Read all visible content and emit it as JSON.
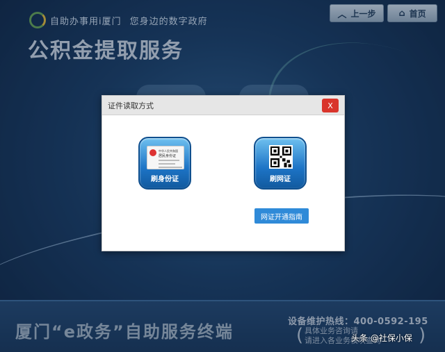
{
  "header": {
    "brand_name": "自助办事用i厦门",
    "slogan": "您身边的数字政府",
    "service_title": "公积金提取服务",
    "back_button": "上一步",
    "home_button": "首页"
  },
  "modal": {
    "title": "证件读取方式",
    "close_label": "X",
    "options": [
      {
        "label": "刷身份证",
        "icon": "id-card-icon"
      },
      {
        "label": "刷网证",
        "icon": "qr-code-icon"
      }
    ],
    "id_card": {
      "line1": "中华人民共和国",
      "line2": "居民身份证"
    },
    "guide_button": "网证开通指南"
  },
  "footer": {
    "terminal_title": "厦门“e政务”自助服务终端",
    "hotline": "设备维护热线：400-0592-195",
    "note_line1": "具体业务咨询请",
    "note_line2": "请进入各业务模块查询"
  },
  "watermark": "头条 @社保小保"
}
